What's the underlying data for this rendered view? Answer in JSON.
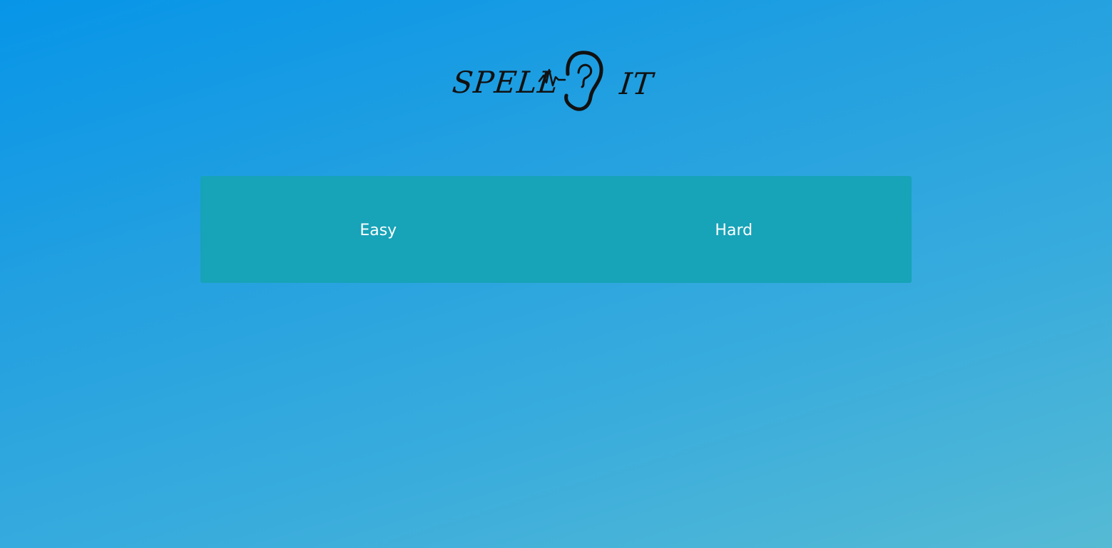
{
  "app": {
    "logo": {
      "word1": "SPELL",
      "word2": "IT",
      "icon": "ear-soundwave-icon"
    }
  },
  "difficulty": {
    "options": [
      {
        "label": "Easy"
      },
      {
        "label": "Hard"
      }
    ]
  },
  "colors": {
    "background_top": "#0795e8",
    "background_bottom": "#55bad4",
    "panel": "#17a3b8",
    "button_text": "#ffffff",
    "logo_ink": "#111111"
  }
}
